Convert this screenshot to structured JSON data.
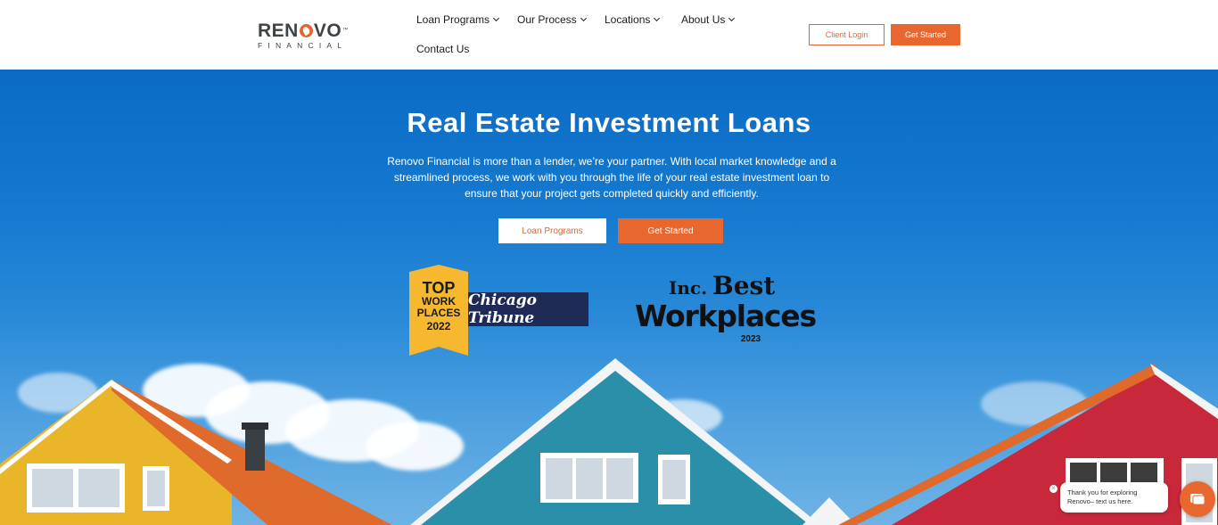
{
  "header": {
    "logo": {
      "word": "RENOVO",
      "sub": "FINANCIAL",
      "tm": "™"
    },
    "nav": [
      {
        "label": "Loan Programs",
        "has_dropdown": true
      },
      {
        "label": "Our Process",
        "has_dropdown": true
      },
      {
        "label": "Locations",
        "has_dropdown": true
      },
      {
        "label": "About Us",
        "has_dropdown": true
      },
      {
        "label": "Contact Us",
        "has_dropdown": false
      }
    ],
    "client_login": "Client Login",
    "get_started": "Get Started"
  },
  "hero": {
    "title": "Real Estate Investment Loans",
    "text": "Renovo Financial is more than a lender, we’re your partner. With local market knowledge and a streamlined process, we work with you through the life of your real estate investment loan to ensure that your project gets completed quickly and efficiently.",
    "btn_loan_programs": "Loan Programs",
    "btn_get_started": "Get Started"
  },
  "awards": {
    "top_workplaces": {
      "line1": "TOP",
      "line2": "WORK",
      "line3": "PLACES",
      "year": "2022",
      "partner": "Chicago Tribune"
    },
    "inc": {
      "brand": "Inc.",
      "title1": "Best",
      "title2": "Workplaces",
      "year": "2023"
    }
  },
  "chat": {
    "message": "Thank you for exploring Renovo– text us here.",
    "close": "×"
  },
  "colors": {
    "accent": "#e8672e",
    "hero_blue": "#1479cf",
    "tribune_navy": "#1f2a56",
    "badge_gold": "#f5b82e"
  }
}
